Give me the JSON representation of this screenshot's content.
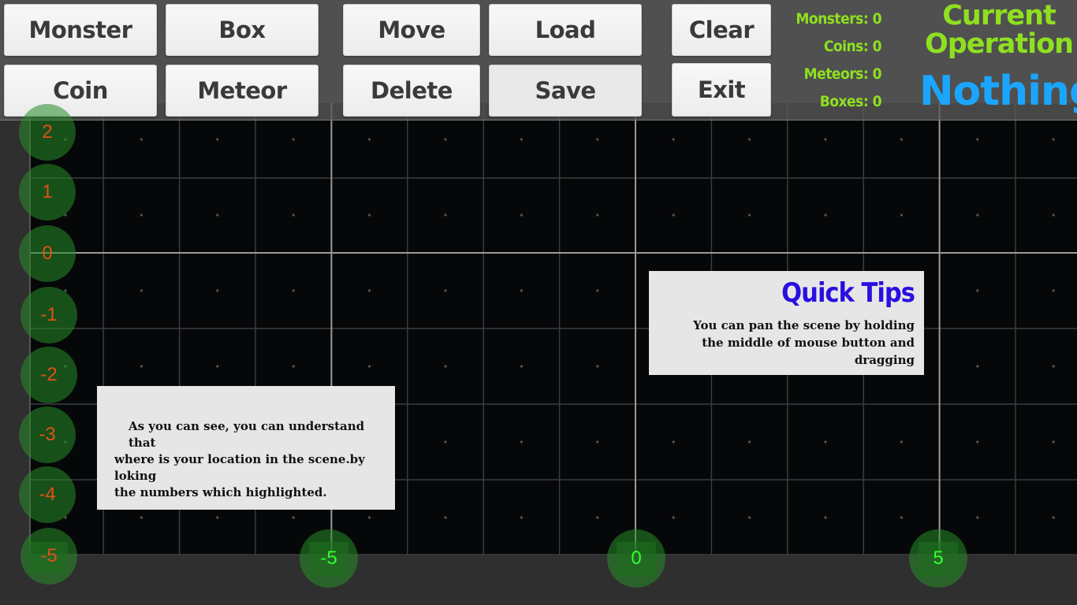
{
  "toolbar": {
    "buttons": {
      "monster": "Monster",
      "box": "Box",
      "coin": "Coin",
      "meteor": "Meteor",
      "move": "Move",
      "load": "Load",
      "delete": "Delete",
      "save": "Save",
      "clear": "Clear",
      "exit": "Exit"
    },
    "stats": {
      "monsters": "Monsters: 0",
      "coins": "Coins: 0",
      "meteors": "Meteors: 0",
      "boxes": "Boxes: 0"
    },
    "current_operation": {
      "title_line1": "Current",
      "title_line2": "Operation",
      "value": "Nothing"
    }
  },
  "axis": {
    "y_labels": [
      "2",
      "1",
      "0",
      "-1",
      "-2",
      "-3",
      "-4",
      "-5"
    ],
    "x_labels": [
      "-5",
      "0",
      "5"
    ]
  },
  "quick_tips": {
    "title": "Quick Tips",
    "line1": "You can pan the scene by holding",
    "line2": "the middle of mouse button and dragging"
  },
  "note": {
    "line1": "As you can see, you can understand that",
    "line2": "where is your location in the scene.by loking",
    "line3": "the numbers which highlighted."
  },
  "colors": {
    "stats": "#8fe020",
    "operation_value": "#1aa6ff",
    "tips_title": "#2a0fe0",
    "y_labels": "#e05018",
    "x_labels": "#33ff33"
  }
}
